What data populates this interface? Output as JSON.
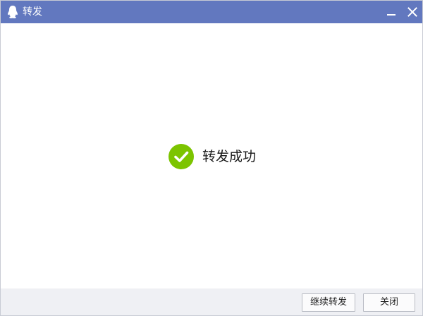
{
  "window": {
    "title": "转发",
    "app_icon": "qq-penguin-icon",
    "controls": {
      "minimize_icon": "minimize-icon",
      "close_icon": "close-icon"
    }
  },
  "content": {
    "status_icon": "check-circle-icon",
    "status_text": "转发成功"
  },
  "footer": {
    "continue_label": "继续转发",
    "close_label": "关闭"
  },
  "colors": {
    "titlebar": "#6278bf",
    "success_green": "#7cc400",
    "footer_bg": "#eff0f4"
  }
}
